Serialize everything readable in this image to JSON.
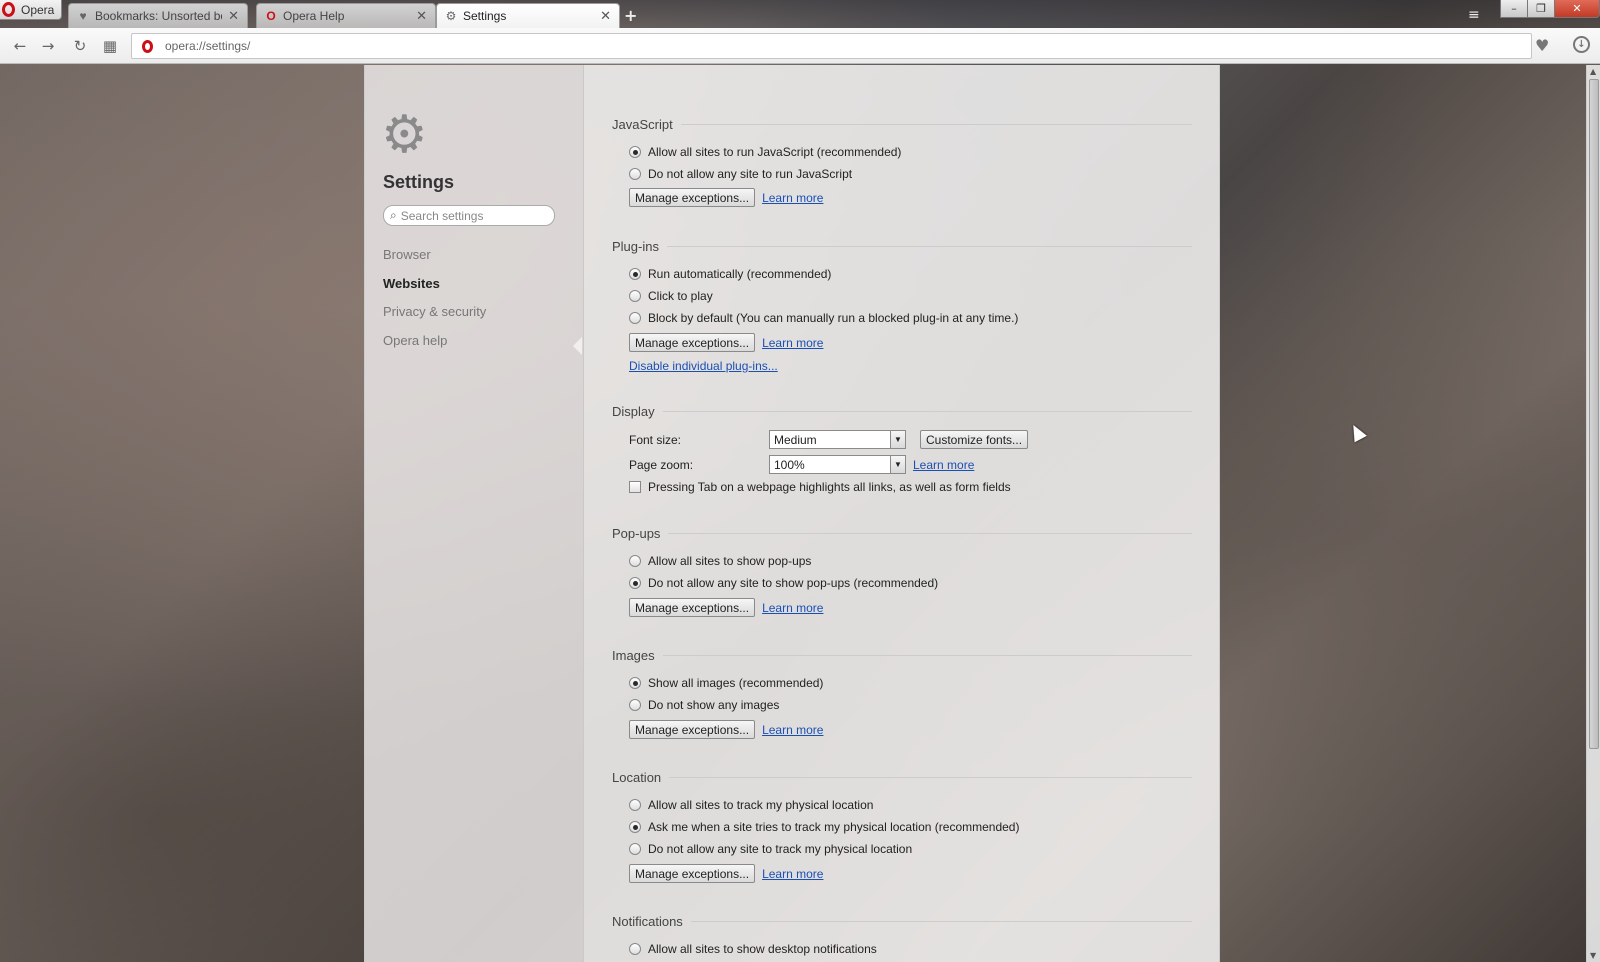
{
  "tabstrip": {
    "menu_label": "Opera",
    "tabs": [
      {
        "title": "Bookmarks: Unsorted boo",
        "icon": "heart-icon",
        "active": false
      },
      {
        "title": "Opera Help",
        "icon": "opera-logo-icon",
        "active": false
      },
      {
        "title": "Settings",
        "icon": "gear-icon",
        "active": true
      }
    ],
    "close_glyph": "✕"
  },
  "toolbar": {
    "url": "opera://settings/"
  },
  "sidebar": {
    "heading": "Settings",
    "search_placeholder": "Search settings",
    "nav": [
      {
        "label": "Browser",
        "selected": false
      },
      {
        "label": "Websites",
        "selected": true
      },
      {
        "label": "Privacy & security",
        "selected": false
      },
      {
        "label": "Opera help",
        "selected": false
      }
    ]
  },
  "common": {
    "manage_exceptions": "Manage exceptions...",
    "learn_more": "Learn more"
  },
  "sections": {
    "javascript": {
      "title": "JavaScript",
      "options": [
        {
          "label": "Allow all sites to run JavaScript (recommended)",
          "checked": true
        },
        {
          "label": "Do not allow any site to run JavaScript",
          "checked": false
        }
      ]
    },
    "plugins": {
      "title": "Plug-ins",
      "options": [
        {
          "label": "Run automatically (recommended)",
          "checked": true
        },
        {
          "label": "Click to play",
          "checked": false
        },
        {
          "label": "Block by default (You can manually run a blocked plug-in at any time.)",
          "checked": false
        }
      ],
      "disable_link": "Disable individual plug-ins..."
    },
    "display": {
      "title": "Display",
      "font_size_label": "Font size:",
      "font_size_value": "Medium",
      "customize_fonts": "Customize fonts...",
      "page_zoom_label": "Page zoom:",
      "page_zoom_value": "100%",
      "tab_highlight_label": "Pressing Tab on a webpage highlights all links, as well as form fields",
      "tab_highlight_checked": false
    },
    "popups": {
      "title": "Pop-ups",
      "options": [
        {
          "label": "Allow all sites to show pop-ups",
          "checked": false
        },
        {
          "label": "Do not allow any site to show pop-ups (recommended)",
          "checked": true
        }
      ]
    },
    "images": {
      "title": "Images",
      "options": [
        {
          "label": "Show all images (recommended)",
          "checked": true
        },
        {
          "label": "Do not show any images",
          "checked": false
        }
      ]
    },
    "location": {
      "title": "Location",
      "options": [
        {
          "label": "Allow all sites to track my physical location",
          "checked": false
        },
        {
          "label": "Ask me when a site tries to track my physical location (recommended)",
          "checked": true
        },
        {
          "label": "Do not allow any site to track my physical location",
          "checked": false
        }
      ]
    },
    "notifications": {
      "title": "Notifications",
      "options": [
        {
          "label": "Allow all sites to show desktop notifications",
          "checked": false
        }
      ]
    }
  }
}
